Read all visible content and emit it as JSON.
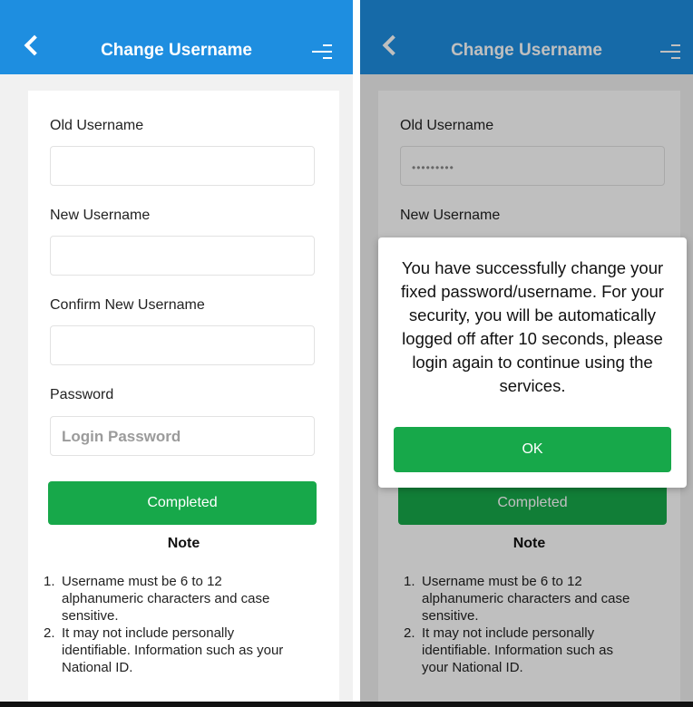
{
  "left_screen": {
    "header": {
      "title": "Change Username",
      "back_icon": "chevron-left-icon",
      "menu_icon": "menu-icon"
    },
    "form": {
      "old_username": {
        "label": "Old Username",
        "value": ""
      },
      "new_username": {
        "label": "New Username",
        "value": ""
      },
      "confirm_new_username": {
        "label": "Confirm New Username",
        "value": ""
      },
      "password": {
        "label": "Password",
        "placeholder": "Login Password",
        "value": ""
      },
      "completed_label": "Completed"
    },
    "note": {
      "title": "Note",
      "items": [
        {
          "num": "1.",
          "text": "Username must be 6 to 12 alphanumeric characters and case sensitive."
        },
        {
          "num": "2.",
          "text": "It may not include personally identifiable. Information such as your National ID."
        }
      ]
    }
  },
  "right_screen": {
    "header": {
      "title": "Change Username",
      "back_icon": "chevron-left-icon",
      "menu_icon": "menu-icon"
    },
    "form": {
      "old_username": {
        "label": "Old Username",
        "value": "•••••••••"
      },
      "new_username": {
        "label": "New Username"
      },
      "completed_label": "Completed"
    },
    "dialog": {
      "message": "You have successfully change your fixed password/username. For your security, you will be automatically logged off after 10 seconds, please login again to continue using the services.",
      "ok_label": "OK"
    },
    "note": {
      "title": "Note",
      "items": [
        {
          "num": "1.",
          "text": "Username must be 6 to 12 alphanumeric characters and case sensitive."
        },
        {
          "num": "2.",
          "text": "It may not include personally identifiable. Information such as your National ID."
        }
      ]
    }
  },
  "colors": {
    "header_blue": "#1e8ee0",
    "button_green": "#17a84a",
    "overlay": "rgba(0,0,0,0.25)"
  }
}
